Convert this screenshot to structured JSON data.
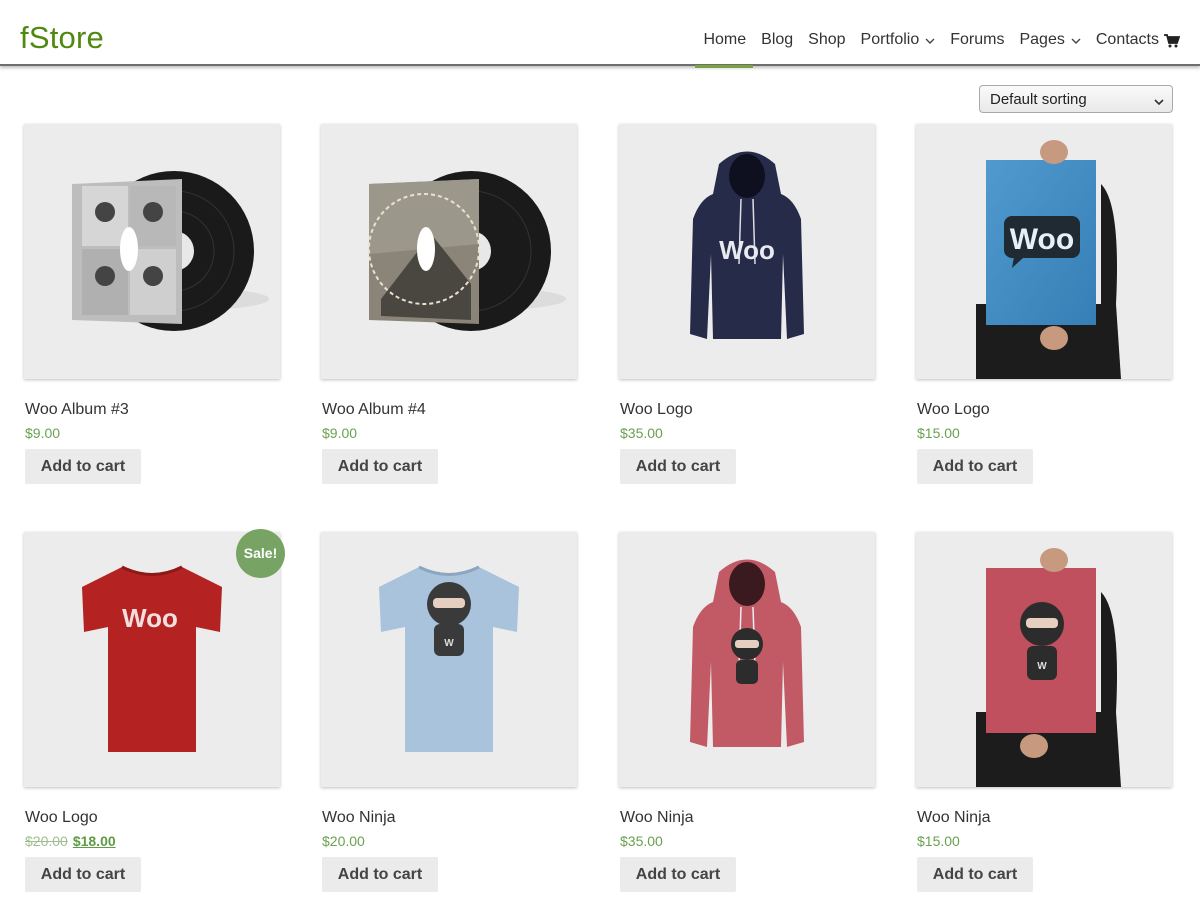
{
  "site": {
    "logo": "fStore",
    "brand_color": "#4f8a10",
    "accent_color": "#7aa444",
    "price_color": "#6aa150"
  },
  "nav": {
    "home": "Home",
    "blog": "Blog",
    "shop": "Shop",
    "portfolio": "Portfolio",
    "forums": "Forums",
    "pages": "Pages",
    "contacts": "Contacts",
    "active": "Home"
  },
  "icons": {
    "cart": "cart-icon",
    "chevron": "chevron-down-icon"
  },
  "sorting": {
    "selected": "Default sorting"
  },
  "products": [
    {
      "title": "Woo Album #3",
      "price": "$9.00",
      "button": "Add to cart",
      "image": "vinyl-album-ninja"
    },
    {
      "title": "Woo Album #4",
      "price": "$9.00",
      "button": "Add to cart",
      "image": "vinyl-album-woothemes"
    },
    {
      "title": "Woo Logo",
      "price": "$35.00",
      "button": "Add to cart",
      "image": "navy-hoodie-woo"
    },
    {
      "title": "Woo Logo",
      "price": "$15.00",
      "button": "Add to cart",
      "image": "blue-poster-woo"
    },
    {
      "title": "Woo Logo",
      "old_price": "$20.00",
      "price": "$18.00",
      "button": "Add to cart",
      "badge": "Sale!",
      "image": "red-tshirt-woo"
    },
    {
      "title": "Woo Ninja",
      "price": "$20.00",
      "button": "Add to cart",
      "image": "lightblue-tshirt-ninja"
    },
    {
      "title": "Woo Ninja",
      "price": "$35.00",
      "button": "Add to cart",
      "image": "pink-hoodie-ninja"
    },
    {
      "title": "Woo Ninja",
      "price": "$15.00",
      "button": "Add to cart",
      "image": "red-poster-ninja"
    }
  ]
}
